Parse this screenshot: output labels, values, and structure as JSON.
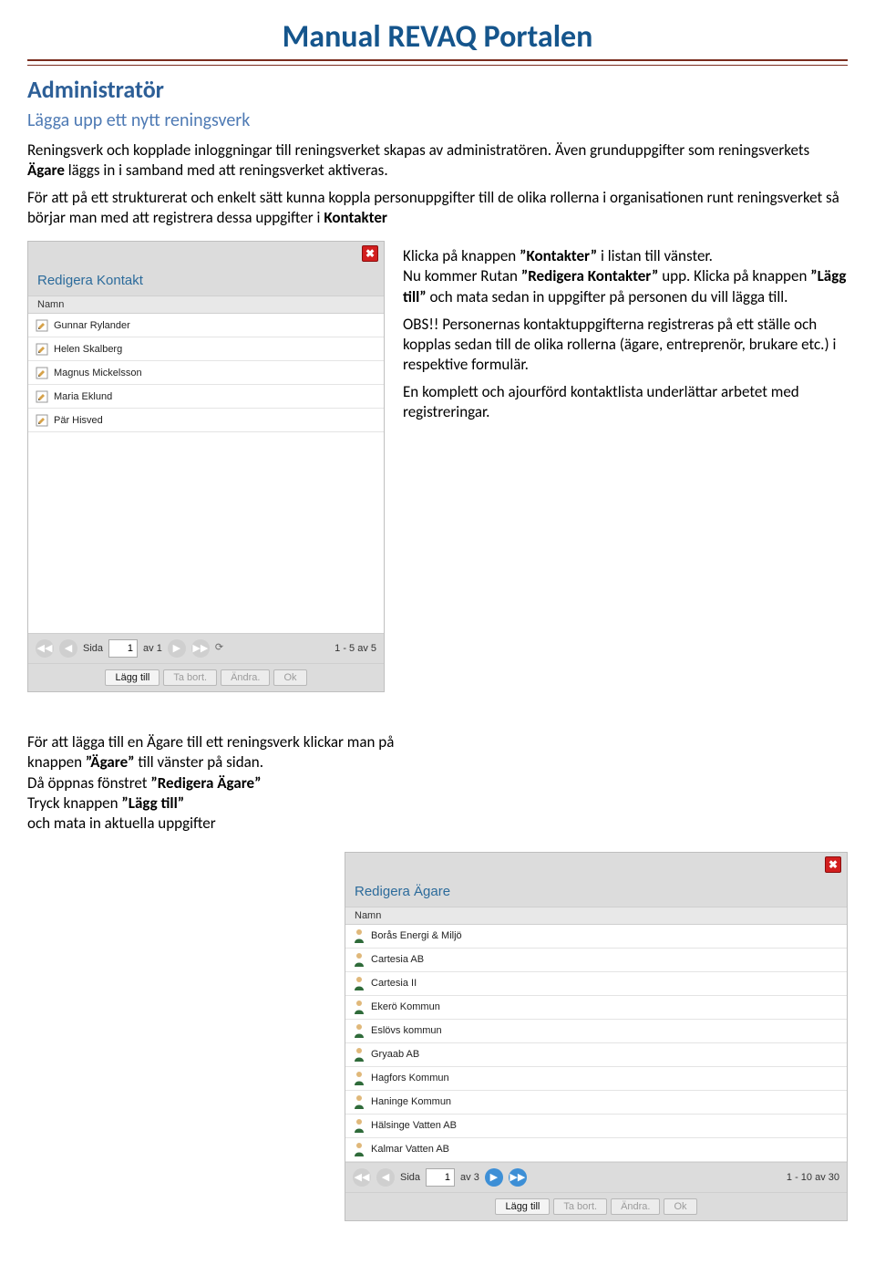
{
  "doc": {
    "main_title": "Manual REVAQ Portalen",
    "section_title": "Administratör",
    "sub_title": "Lägga upp ett nytt reningsverk",
    "intro1a": "Reningsverk och kopplade inloggningar till reningsverket skapas av administratören. Även grunduppgifter som reningsverkets ",
    "intro1b": "Ägare",
    "intro1c": " läggs in i samband med att reningsverket aktiveras.",
    "intro2a": "För att på ett strukturerat och enkelt sätt kunna koppla personuppgifter till de olika rollerna i organisationen runt reningsverket så börjar man med att registrera dessa uppgifter i ",
    "intro2b": "Kontakter",
    "right_p1a": "Klicka på knappen ",
    "right_p1b": "”Kontakter”",
    "right_p1c": " i listan till vänster.",
    "right_p2a": " Nu kommer Rutan ",
    "right_p2b": "”Redigera Kontakter”",
    "right_p2c": " upp. Klicka på knappen ",
    "right_p2d": "”Lägg till”",
    "right_p2e": " och mata sedan in uppgifter på personen du vill lägga till.",
    "right_p3a": "OBS!! Personernas kontaktuppgifterna registreras på ett ställe och kopplas sedan till de olika rollerna (ägare, entreprenör, brukare etc.) i respektive formulär.",
    "right_p4": "En komplett och ajourförd kontaktlista underlättar arbetet med registreringar.",
    "bottom1a": "För att lägga till en Ägare till ett reningsverk klickar man på knappen ",
    "bottom1b": "”Ägare”",
    "bottom1c": " till vänster på sidan.",
    "bottom2a": "Då öppnas fönstret ",
    "bottom2b": " ”Redigera Ägare”",
    "bottom3a": "Tryck knappen ",
    "bottom3b": "”Lägg till”",
    "bottom4": "och mata in aktuella uppgifter"
  },
  "kontakt_panel": {
    "title": "Redigera Kontakt",
    "col_header": "Namn",
    "rows": [
      "Gunnar Rylander",
      "Helen Skalberg",
      "Magnus Mickelsson",
      "Maria Eklund",
      "Pär Hisved"
    ],
    "pager": {
      "side_label": "Sida",
      "page": "1",
      "av_label": "av 1",
      "range": "1 - 5 av 5"
    },
    "buttons": {
      "add": "Lägg till",
      "remove": "Ta bort.",
      "edit": "Ändra.",
      "ok": "Ok"
    }
  },
  "agare_panel": {
    "title": "Redigera Ägare",
    "col_header": "Namn",
    "rows": [
      "Borås Energi & Miljö",
      "Cartesia AB",
      "Cartesia II",
      "Ekerö Kommun",
      "Eslövs kommun",
      "Gryaab AB",
      "Hagfors Kommun",
      "Haninge Kommun",
      "Hälsinge Vatten AB",
      "Kalmar Vatten AB"
    ],
    "pager": {
      "side_label": "Sida",
      "page": "1",
      "av_label": "av 3",
      "range": "1 - 10 av 30"
    },
    "buttons": {
      "add": "Lägg till",
      "remove": "Ta bort.",
      "edit": "Ändra.",
      "ok": "Ok"
    }
  }
}
